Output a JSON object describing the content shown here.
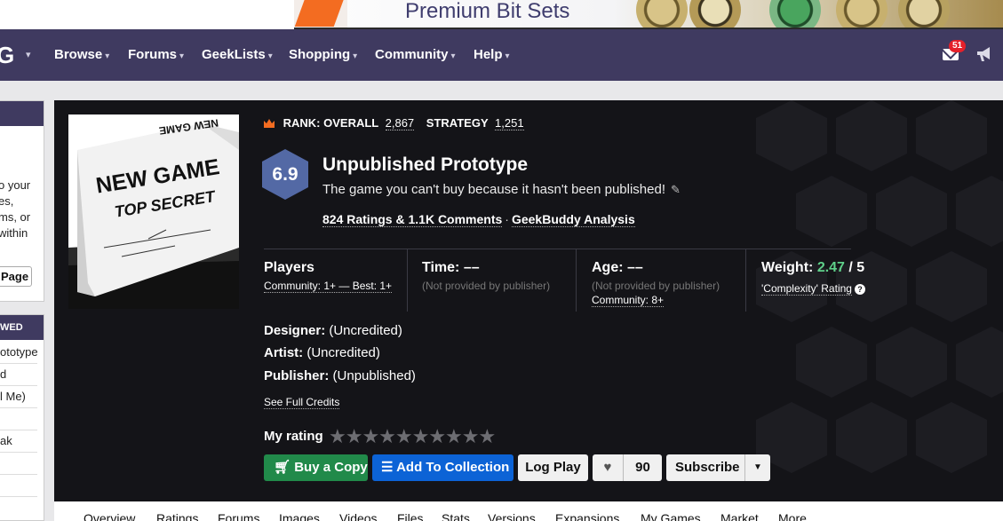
{
  "ad": {
    "text": "Premium Bit Sets"
  },
  "nav": {
    "logo_letter": "G",
    "items": [
      {
        "label": "Browse"
      },
      {
        "label": "Forums"
      },
      {
        "label": "GeekLists"
      },
      {
        "label": "Shopping"
      },
      {
        "label": "Community"
      },
      {
        "label": "Help"
      }
    ],
    "mail_count": "51",
    "icons": [
      "mail-icon",
      "megaphone-icon",
      "chevron-down-icon"
    ]
  },
  "sidebar": {
    "partial_lines": [
      "o your",
      "es,",
      "ms, or",
      "within"
    ],
    "page_button": "Page",
    "recent_header": "WED",
    "recent_items": [
      "ototype",
      "d",
      "l Me)",
      "",
      "ak",
      "",
      ""
    ]
  },
  "game": {
    "box_art": {
      "line1": "NEW GAME",
      "line2": "TOP SECRET",
      "spine": "NEW GAME"
    },
    "rank_overall_label": "RANK: OVERALL",
    "rank_overall": "2,867",
    "rank_strategy_label": "STRATEGY",
    "rank_strategy": "1,251",
    "rating": "6.9",
    "title": "Unpublished Prototype",
    "subtitle": "The game you can't buy because it hasn't been published!",
    "ratings_link": "824 Ratings & 1.1K Comments",
    "separator": "·",
    "analysis_link": "GeekBuddy Analysis",
    "stats": {
      "players_label": "Players",
      "players_sub": "Community: 1+ — Best: 1+",
      "time_label": "Time: ––",
      "time_sub": "(Not provided by publisher)",
      "age_label": "Age: ––",
      "age_sub": "(Not provided by publisher)",
      "age_community": "Community: 8+",
      "weight_label": "Weight:",
      "weight_value": "2.47",
      "weight_max": "/ 5",
      "weight_sub": "'Complexity' Rating"
    },
    "designer_label": "Designer:",
    "designer": "(Uncredited)",
    "artist_label": "Artist:",
    "artist": "(Uncredited)",
    "publisher_label": "Publisher:",
    "publisher": "(Unpublished)",
    "see_credits": "See Full Credits",
    "my_rating_label": "My rating",
    "stars": "★★★★★★★★★★"
  },
  "actions": {
    "buy": "Buy a Copy",
    "collection": "Add To Collection",
    "log_play": "Log Play",
    "fans": "90",
    "subscribe": "Subscribe"
  },
  "tabs": [
    "Overview",
    "Ratings",
    "Forums",
    "Images",
    "Videos",
    "Files",
    "Stats",
    "Versions",
    "Expansions",
    "My Games",
    "Market",
    "More"
  ],
  "colors": {
    "nav_bg": "#3f3a60",
    "panel_bg": "#141418",
    "rating_hex": "#5369a5",
    "buy_green": "#218a4a",
    "collection_blue": "#0c63d6",
    "weight_green": "#5fd08a",
    "badge_red": "#e5202a"
  }
}
